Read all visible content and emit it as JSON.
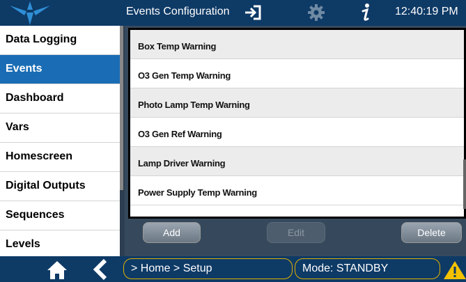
{
  "header": {
    "title": "Events Configuration",
    "time": "12:40:19 PM",
    "icons": [
      "logo",
      "exit-icon",
      "gear-icon",
      "info-icon"
    ]
  },
  "sidebar": {
    "items": [
      {
        "label": "Data Logging",
        "active": false
      },
      {
        "label": "Events",
        "active": true
      },
      {
        "label": "Dashboard",
        "active": false
      },
      {
        "label": "Vars",
        "active": false
      },
      {
        "label": "Homescreen",
        "active": false
      },
      {
        "label": "Digital Outputs",
        "active": false
      },
      {
        "label": "Sequences",
        "active": false
      },
      {
        "label": "Levels",
        "active": false
      }
    ]
  },
  "events_list": {
    "items": [
      "Box Temp Warning",
      "O3 Gen Temp Warning",
      "Photo Lamp Temp Warning",
      "O3 Gen Ref Warning",
      "Lamp Driver Warning",
      "Power Supply Temp Warning"
    ]
  },
  "buttons": {
    "add": "Add",
    "edit": "Edit",
    "delete": "Delete"
  },
  "footer": {
    "breadcrumb": "> Home > Setup",
    "mode": "Mode: STANDBY",
    "icons": [
      "home-icon",
      "back-icon",
      "warning-icon"
    ]
  },
  "colors": {
    "header_bg": "#0e3a66",
    "active_nav": "#1a6db5",
    "panel_bg": "#36495c",
    "status_border": "#e0b100",
    "warning": "#f2c200"
  }
}
